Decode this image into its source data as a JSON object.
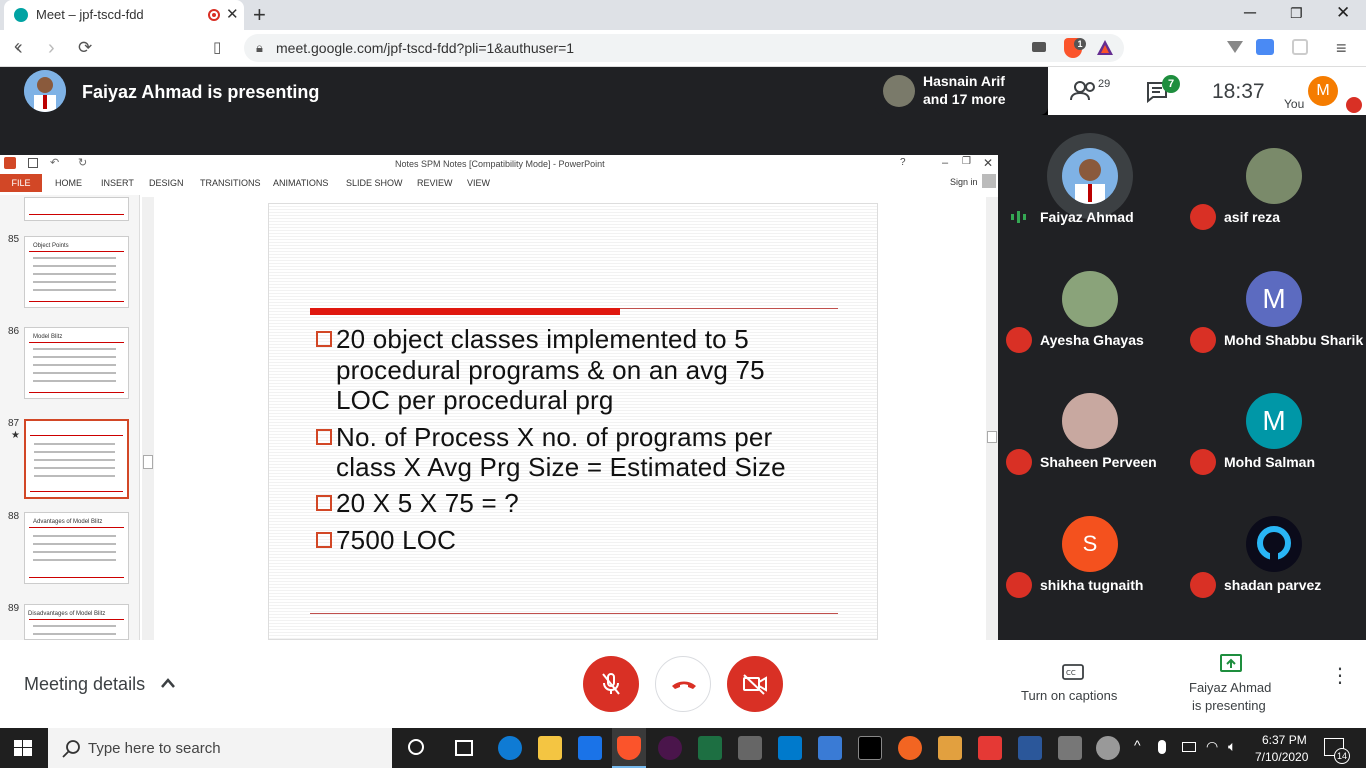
{
  "browser": {
    "tab_title": "Meet – jpf-tscd-fdd",
    "url": "meet.google.com/jpf-tscd-fdd?pli=1&authuser=1",
    "brave_badge": "1"
  },
  "meet": {
    "presenter_banner": "Faiyaz Ahmad is presenting",
    "others_line1": "Hasnain Arif",
    "others_line2": "and 17 more",
    "people_count": "29",
    "chat_count": "7",
    "clock": "18:37",
    "self_initial": "M",
    "self_label": "You"
  },
  "powerpoint": {
    "window_title": "Notes SPM Notes [Compatibility Mode] - PowerPoint",
    "ribbon_tabs": [
      "FILE",
      "HOME",
      "INSERT",
      "DESIGN",
      "TRANSITIONS",
      "ANIMATIONS",
      "SLIDE SHOW",
      "REVIEW",
      "VIEW"
    ],
    "sign_in": "Sign in",
    "thumbnails": [
      {
        "num": "85",
        "title": "Object Points"
      },
      {
        "num": "86",
        "title": "Model Blitz"
      },
      {
        "num": "87",
        "title": "",
        "marker": "★"
      },
      {
        "num": "88",
        "title": "Advantages of Model Blitz"
      },
      {
        "num": "89",
        "title": "Disadvantages of Model Blitz"
      }
    ],
    "slide_bullets": [
      {
        "line1": "20 object classes implemented to 5",
        "line2": "procedural programs & on an avg 75",
        "line3": "LOC per procedural prg"
      },
      {
        "line1": "No. of Process  X no. of programs per",
        "line2": "class X Avg Prg Size = Estimated Size"
      },
      {
        "line1": "20 X 5 X 75 = ?"
      },
      {
        "line1": "7500 LOC"
      }
    ]
  },
  "participants": [
    {
      "name": "Faiyaz Ahmad",
      "avatar": "photo",
      "speaking": true
    },
    {
      "name": "asif reza",
      "avatar": "photo",
      "mic": "muted"
    },
    {
      "name": "Ayesha Ghayas",
      "avatar": "photo",
      "mic": "muted"
    },
    {
      "name": "Mohd Shabbu Sharik",
      "avatar": "M",
      "color": "#5c6bc0",
      "mic": "muted"
    },
    {
      "name": "Shaheen Perveen",
      "avatar": "photo",
      "mic": "muted"
    },
    {
      "name": "Mohd Salman",
      "avatar": "M",
      "color": "#0097a7",
      "mic": "muted"
    },
    {
      "name": "shikha tugnaith",
      "avatar": "S",
      "color": "#f4511e",
      "mic": "muted"
    },
    {
      "name": "shadan parvez",
      "avatar": "icon",
      "mic": "muted"
    }
  ],
  "bottom": {
    "meeting_details": "Meeting details",
    "captions": "Turn on captions",
    "presenting_line1": "Faiyaz Ahmad",
    "presenting_line2": "is presenting"
  },
  "taskbar": {
    "search_placeholder": "Type here to search",
    "time": "6:37 PM",
    "date": "7/10/2020",
    "notifications": "14"
  },
  "colors": {
    "meet_dark": "#202124",
    "mute_red": "#d93025",
    "ppt_orange": "#d24726",
    "slide_red": "#e0180f"
  }
}
